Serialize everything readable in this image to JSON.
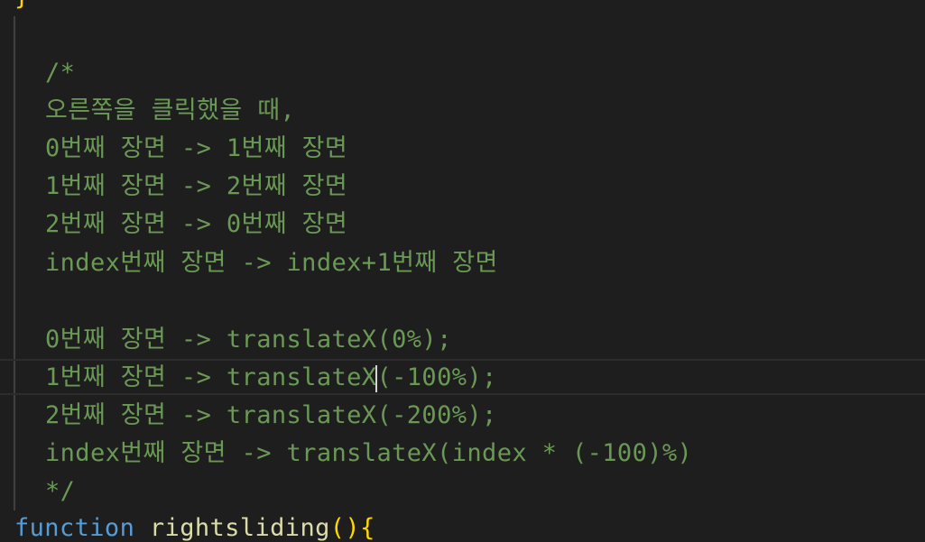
{
  "editor": {
    "closing_brace": "}",
    "comment": {
      "open": "/*",
      "line1": "오른쪽을 클릭했을 때,",
      "line2": "0번째 장면 -> 1번째 장면",
      "line3": "1번째 장면 -> 2번째 장면",
      "line4": "2번째 장면 -> 0번째 장면",
      "line5": "index번째 장면 -> index+1번째 장면",
      "line7": "0번째 장면 -> translateX(0%);",
      "line8_before_cursor": "1번째 장면 -> translateX",
      "line8_after_cursor": "(-100%);",
      "line9": "2번째 장면 -> translateX(-200%);",
      "line10": "index번째 장면 -> translateX(index * (-100)%)",
      "close": "*/"
    },
    "function_line": {
      "keyword": "function",
      "name": "rightsliding",
      "parens": "()",
      "brace": "{"
    }
  },
  "colors": {
    "background": "#1e1e1e",
    "comment": "#6a9955",
    "keyword": "#569cd6",
    "function_name": "#dcdcaa",
    "bracket": "#ffd700"
  }
}
